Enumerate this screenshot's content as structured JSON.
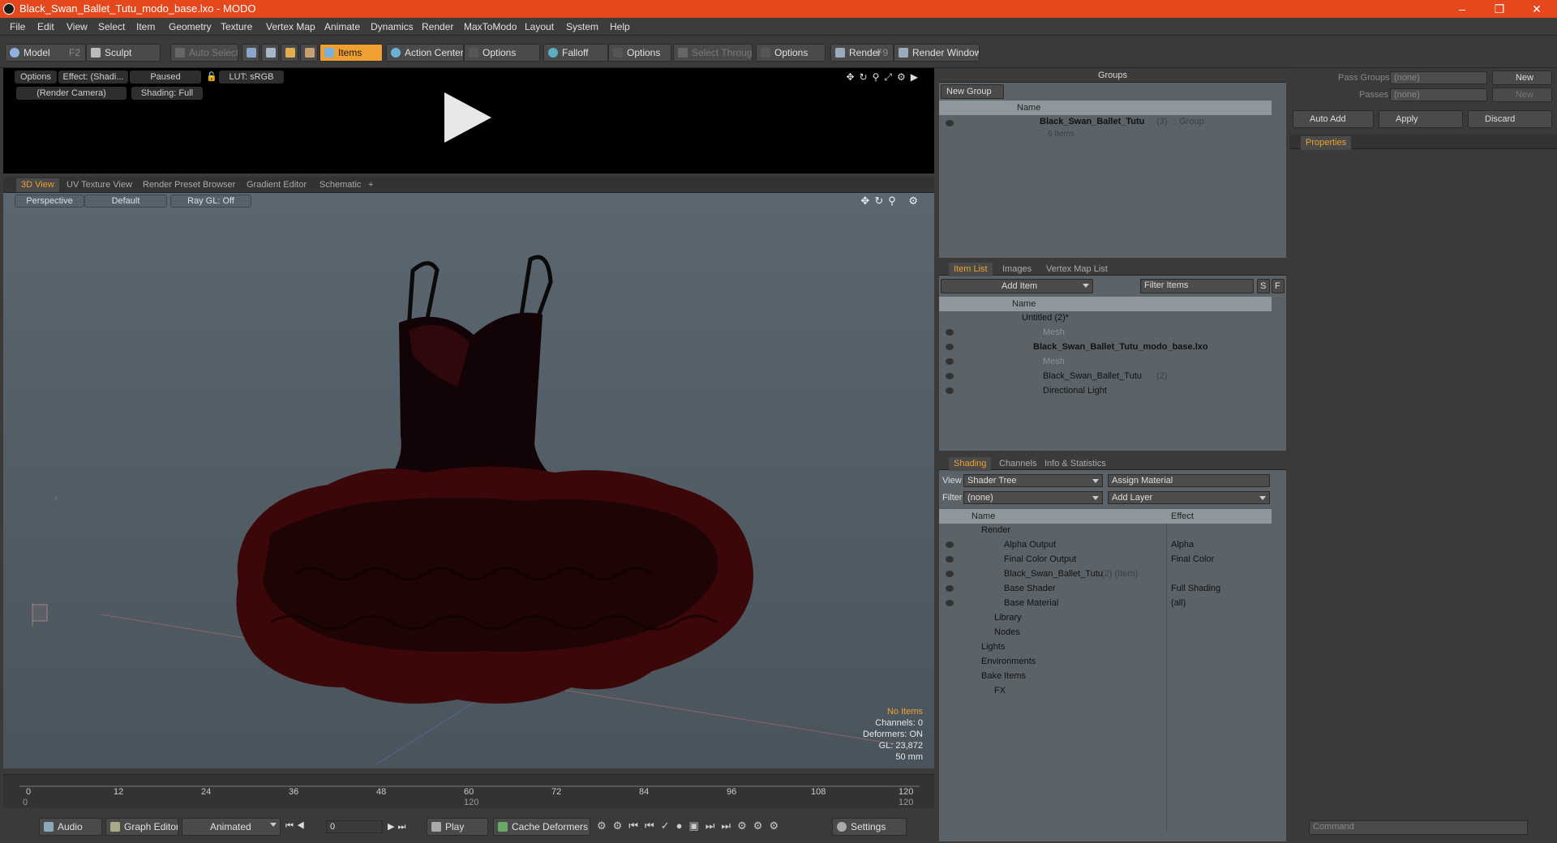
{
  "window": {
    "title": "Black_Swan_Ballet_Tutu_modo_base.lxo - MODO"
  },
  "menu": [
    "File",
    "Edit",
    "View",
    "Select",
    "Item",
    "Geometry",
    "Texture",
    "Vertex Map",
    "Animate",
    "Dynamics",
    "Render",
    "MaxToModo",
    "Layout",
    "System",
    "Help"
  ],
  "toolbar": {
    "model": "Model",
    "model_key": "F2",
    "sculpt": "Sculpt",
    "auto_select": "Auto Select",
    "items": "Items",
    "action_center": "Action Center",
    "options1": "Options",
    "falloff": "Falloff",
    "options2": "Options",
    "select_through": "Select Through",
    "options3": "Options",
    "render": "Render",
    "render_key": "F9",
    "render_window": "Render Window"
  },
  "preview": {
    "options": "Options",
    "effect": "Effect: (Shadi...",
    "paused": "Paused",
    "lut": "LUT: sRGB",
    "camera": "(Render Camera)",
    "shading": "Shading: Full"
  },
  "view_tabs": [
    "3D View",
    "UV Texture View",
    "Render Preset Browser",
    "Gradient Editor",
    "Schematic"
  ],
  "viewport": {
    "perspective": "Perspective",
    "default": "Default",
    "raygl": "Ray GL: Off",
    "stats": {
      "no_items": "No Items",
      "channels": "Channels: 0",
      "deformers": "Deformers: ON",
      "gl": "GL: 23,872",
      "mm": "50 mm"
    }
  },
  "timeline": {
    "ticks": [
      "0",
      "12",
      "24",
      "36",
      "48",
      "60",
      "72",
      "84",
      "96",
      "108",
      "120"
    ],
    "range_start": "0",
    "range_mid": "120",
    "range_end": "120"
  },
  "bottombar": {
    "audio": "Audio",
    "graph_editor": "Graph Editor",
    "animated": "Animated",
    "frame": "0",
    "play": "Play",
    "cache": "Cache Deformers",
    "settings": "Settings"
  },
  "groups": {
    "title": "Groups",
    "new_group": "New Group",
    "col_name": "Name",
    "item_name": "Black_Swan_Ballet_Tutu",
    "item_count": "(3)",
    "item_type": ": Group",
    "item_sub": "6 Items"
  },
  "itemlist": {
    "tabs": [
      "Item List",
      "Images",
      "Vertex Map List"
    ],
    "add_item": "Add Item",
    "filter": "Filter Items",
    "s": "S",
    "f": "F",
    "col_name": "Name",
    "rows": [
      {
        "label": "Untitled (2)*",
        "dim": false
      },
      {
        "label": "Mesh",
        "dim": true
      },
      {
        "label": "Black_Swan_Ballet_Tutu_modo_base.lxo",
        "dim": false
      },
      {
        "label": "Mesh",
        "dim": true
      },
      {
        "label": "Black_Swan_Ballet_Tutu",
        "dim": false,
        "suffix": "(2)"
      },
      {
        "label": "Directional Light",
        "dim": false
      }
    ]
  },
  "shading": {
    "tabs": [
      "Shading",
      "Channels",
      "Info & Statistics"
    ],
    "view_label": "View",
    "view_value": "Shader Tree",
    "assign_material": "Assign Material",
    "filter_label": "Filter",
    "filter_value": "(none)",
    "add_layer": "Add Layer",
    "col_name": "Name",
    "col_effect": "Effect",
    "rows": [
      {
        "label": "Render",
        "effect": "",
        "suffix": ""
      },
      {
        "label": "Alpha Output",
        "effect": "Alpha",
        "suffix": ""
      },
      {
        "label": "Final Color Output",
        "effect": "Final Color",
        "suffix": ""
      },
      {
        "label": "Black_Swan_Ballet_Tutu",
        "effect": "",
        "suffix": "(2) (Item)"
      },
      {
        "label": "Base Shader",
        "effect": "Full Shading",
        "suffix": ""
      },
      {
        "label": "Base Material",
        "effect": "(all)",
        "suffix": ""
      },
      {
        "label": "Library",
        "effect": "",
        "suffix": ""
      },
      {
        "label": "Nodes",
        "effect": "",
        "suffix": ""
      },
      {
        "label": "Lights",
        "effect": "",
        "suffix": ""
      },
      {
        "label": "Environments",
        "effect": "",
        "suffix": ""
      },
      {
        "label": "Bake Items",
        "effect": "",
        "suffix": ""
      },
      {
        "label": "FX",
        "effect": "",
        "suffix": ""
      }
    ]
  },
  "properties": {
    "pass_groups": "Pass Groups",
    "passes": "Passes",
    "none": "(none)",
    "new": "New",
    "auto_add": "Auto Add",
    "apply": "Apply",
    "discard": "Discard",
    "tab": "Properties",
    "command": "Command"
  },
  "colors": {
    "accent": "#f0a030",
    "titlebar": "#e4481c"
  }
}
